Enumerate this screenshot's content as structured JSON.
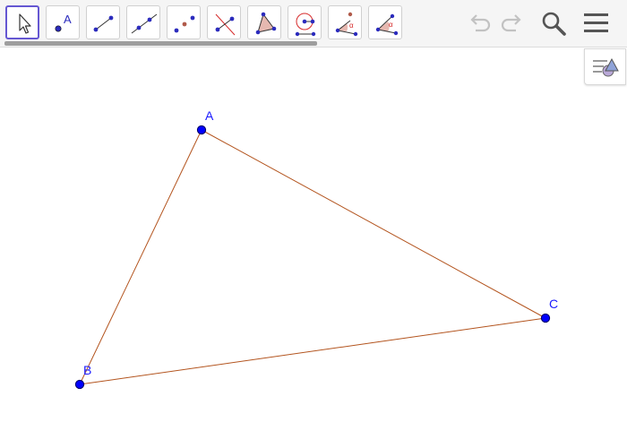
{
  "toolbar": {
    "tools": [
      {
        "name": "move-tool",
        "icon": "arrow-pointer-icon",
        "selected": true
      },
      {
        "name": "point-tool",
        "icon": "point-icon",
        "label": "A"
      },
      {
        "name": "segment-tool",
        "icon": "segment-icon"
      },
      {
        "name": "line-tool",
        "icon": "line-icon"
      },
      {
        "name": "midpoint-tool",
        "icon": "midpoint-icon"
      },
      {
        "name": "perpendicular-bisector-tool",
        "icon": "perpendicular-icon"
      },
      {
        "name": "polygon-tool",
        "icon": "polygon-icon"
      },
      {
        "name": "circle-tool",
        "icon": "circle-center-point-icon"
      },
      {
        "name": "angle-tool",
        "icon": "angle-icon",
        "label": "α"
      },
      {
        "name": "angle-given-size-tool",
        "icon": "angle-given-size-icon",
        "label": "α"
      }
    ],
    "undo_icon": "undo-icon",
    "redo_icon": "redo-icon",
    "search_icon": "search-icon",
    "menu_icon": "menu-icon"
  },
  "algebra_toggle": {
    "icon": "algebra-view-icon"
  },
  "colors": {
    "point": "#0000ff",
    "point_stroke": "#00006b",
    "label": "#1a1aff",
    "segment": "#b3541e",
    "selected_border": "#6557d2",
    "polygon_fill": "#e6b8b0"
  },
  "construction": {
    "points": [
      {
        "name": "A",
        "label": "A"
      },
      {
        "name": "B",
        "label": "B"
      },
      {
        "name": "C",
        "label": "C"
      }
    ],
    "segments": [
      "AB",
      "BC",
      "CA"
    ]
  }
}
